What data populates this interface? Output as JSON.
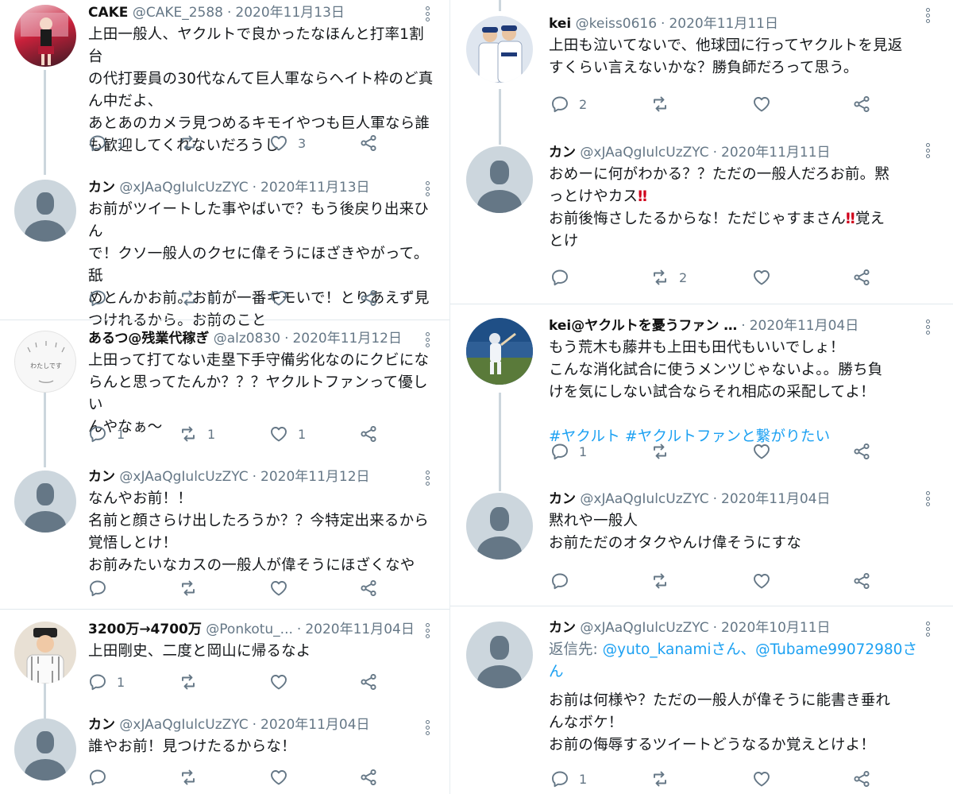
{
  "left_column": {
    "t1": {
      "name": "CAKE",
      "handle": "@CAKE_2588",
      "date": "2020年11月13日",
      "text": "上田一般人、ヤクルトで良かったなほんと打率1割台\nの代打要員の30代なんて巨人軍ならヘイト枠のど真\nん中だよ、\nあとあのカメラ見つめるキモイやつも巨人軍なら誰\nも歓迎してくれないだろうし",
      "replies": "1",
      "likes": "3"
    },
    "t2": {
      "name": "カン",
      "handle": "@xJAaQgIulcUzZYC",
      "date": "2020年11月13日",
      "text": "お前がツイートした事やばいで？もう後戻り出来ひん\nで！クソ一般人のクセに偉そうにほざきやがって。舐\nめとんかお前。お前が一番キモいで！とりあえず見\nつけれるから。お前のこと",
      "retweets": "3"
    },
    "t3": {
      "name": "あるつ@残業代稼ぎ",
      "handle": "@alz0830",
      "date": "2020年11月12日",
      "avatar_text": "わたしです",
      "text": "上田って打てない走塁下手守備劣化なのにクビにな\nらんと思ってたんか？？？ヤクルトファンって優しい\nんやなぁ〜",
      "replies": "1",
      "retweets": "1",
      "likes": "1"
    },
    "t4": {
      "name": "カン",
      "handle": "@xJAaQgIulcUzZYC",
      "date": "2020年11月12日",
      "text": "なんやお前！！\n名前と顔さらけ出したろうか？？今特定出来るから\n覚悟しとけ！\nお前みたいなカスの一般人が偉そうにほざくなや"
    },
    "t5": {
      "name": "3200万→4700万",
      "handle": "@Ponkotu_...",
      "date": "2020年11月04日",
      "text": "上田剛史、二度と岡山に帰るなよ",
      "replies": "1"
    },
    "t6": {
      "name": "カン",
      "handle": "@xJAaQgIulcUzZYC",
      "date": "2020年11月04日",
      "text": "誰やお前！見つけたるからな！"
    }
  },
  "right_column": {
    "t1": {
      "name": "kei",
      "handle": "@keiss0616",
      "date": "2020年11月11日",
      "text": "上田も泣いてないで、他球団に行ってヤクルトを見返\nすくらい言えないかな？勝負師だろって思う。",
      "replies": "2"
    },
    "t2": {
      "name": "カン",
      "handle": "@xJAaQgIulcUzZYC",
      "date": "2020年11月11日",
      "line1": "おめーに何がわかる？？ただの一般人だろお前。黙",
      "line2a": "っとけやカス",
      "bang": "‼",
      "line3a": "お前後悔さしたるからな！ただじゃすまさん",
      "line3b": "覚え",
      "line4": "とけ",
      "retweets": "2"
    },
    "t3": {
      "name": "kei@ヤクルトを憂うファン …",
      "date": "2020年11月04日",
      "text": "もう荒木も藤井も上田も田代もいいでしょ！\nこんな消化試合に使うメンツじゃないよ。。勝ち負\nけを気にしない試合ならそれ相応の采配してよ！",
      "hashtag1": "#ヤクルト",
      "hashtag2": "#ヤクルトファンと繋がりたい",
      "replies": "1"
    },
    "t4": {
      "name": "カン",
      "handle": "@xJAaQgIulcUzZYC",
      "date": "2020年11月04日",
      "text": "黙れや一般人\nお前ただのオタクやんけ偉そうにすな"
    },
    "t5": {
      "name": "カン",
      "handle": "@xJAaQgIulcUzZYC",
      "date": "2020年10月11日",
      "reply_prefix": "返信先: ",
      "reply_link1": "@yuto_kanamiさん",
      "reply_sep": "、",
      "reply_link2": "@Tubame99072980さ",
      "reply_line2": "ん",
      "text": "お前は何様や？ただの一般人が偉そうに能書き垂れ\nんなボケ！\nお前の侮辱するツイートどうなるか覚えとけよ！",
      "replies": "1"
    }
  }
}
